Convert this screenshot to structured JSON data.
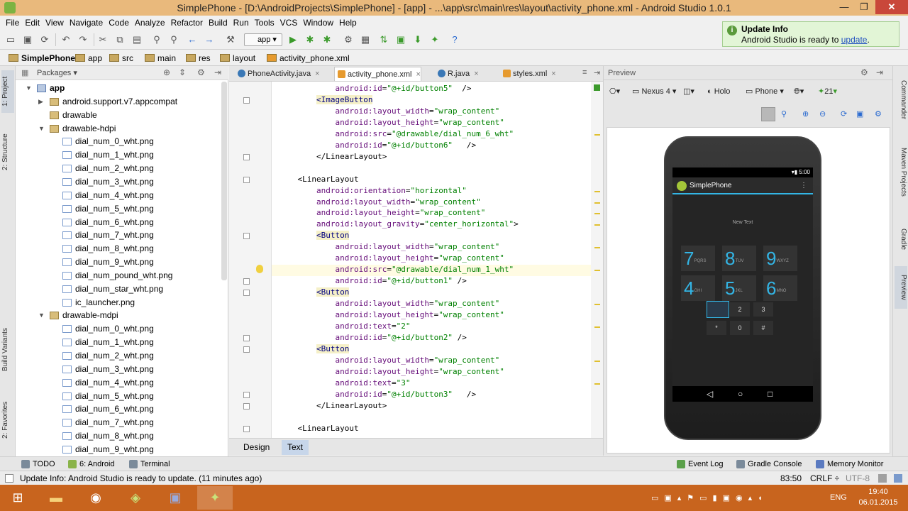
{
  "window": {
    "title": "SimplePhone - [D:\\AndroidProjects\\SimplePhone] - [app] - ...\\app\\src\\main\\res\\layout\\activity_phone.xml - Android Studio 1.0.1"
  },
  "menu": [
    "File",
    "Edit",
    "View",
    "Navigate",
    "Code",
    "Analyze",
    "Refactor",
    "Build",
    "Run",
    "Tools",
    "VCS",
    "Window",
    "Help"
  ],
  "toolbar": {
    "run_config": "app"
  },
  "breadcrumb": [
    "SimplePhone",
    "app",
    "src",
    "main",
    "res",
    "layout",
    "activity_phone.xml"
  ],
  "notification": {
    "title": "Update Info",
    "body": "Android Studio is ready to ",
    "link": "update",
    "suffix": "."
  },
  "left_stripe": [
    "1: Project",
    "2: Structure",
    "Build Variants",
    "2: Favorites"
  ],
  "right_stripe": [
    "Commander",
    "Maven Projects",
    "Gradle",
    "Preview"
  ],
  "project": {
    "view": "Packages",
    "tree": [
      {
        "label": "app",
        "level": 0,
        "type": "module",
        "expanded": true
      },
      {
        "label": "android.support.v7.appcompat",
        "level": 1,
        "type": "folder",
        "expanded": false
      },
      {
        "label": "drawable",
        "level": 1,
        "type": "folder",
        "expanded": null
      },
      {
        "label": "drawable-hdpi",
        "level": 1,
        "type": "folder",
        "expanded": true
      },
      {
        "label": "dial_num_0_wht.png",
        "level": 2,
        "type": "img"
      },
      {
        "label": "dial_num_1_wht.png",
        "level": 2,
        "type": "img"
      },
      {
        "label": "dial_num_2_wht.png",
        "level": 2,
        "type": "img"
      },
      {
        "label": "dial_num_3_wht.png",
        "level": 2,
        "type": "img"
      },
      {
        "label": "dial_num_4_wht.png",
        "level": 2,
        "type": "img"
      },
      {
        "label": "dial_num_5_wht.png",
        "level": 2,
        "type": "img"
      },
      {
        "label": "dial_num_6_wht.png",
        "level": 2,
        "type": "img"
      },
      {
        "label": "dial_num_7_wht.png",
        "level": 2,
        "type": "img"
      },
      {
        "label": "dial_num_8_wht.png",
        "level": 2,
        "type": "img"
      },
      {
        "label": "dial_num_9_wht.png",
        "level": 2,
        "type": "img"
      },
      {
        "label": "dial_num_pound_wht.png",
        "level": 2,
        "type": "img"
      },
      {
        "label": "dial_num_star_wht.png",
        "level": 2,
        "type": "img"
      },
      {
        "label": "ic_launcher.png",
        "level": 2,
        "type": "img"
      },
      {
        "label": "drawable-mdpi",
        "level": 1,
        "type": "folder",
        "expanded": true
      },
      {
        "label": "dial_num_0_wht.png",
        "level": 2,
        "type": "img"
      },
      {
        "label": "dial_num_1_wht.png",
        "level": 2,
        "type": "img"
      },
      {
        "label": "dial_num_2_wht.png",
        "level": 2,
        "type": "img"
      },
      {
        "label": "dial_num_3_wht.png",
        "level": 2,
        "type": "img"
      },
      {
        "label": "dial_num_4_wht.png",
        "level": 2,
        "type": "img"
      },
      {
        "label": "dial_num_5_wht.png",
        "level": 2,
        "type": "img"
      },
      {
        "label": "dial_num_6_wht.png",
        "level": 2,
        "type": "img"
      },
      {
        "label": "dial_num_7_wht.png",
        "level": 2,
        "type": "img"
      },
      {
        "label": "dial_num_8_wht.png",
        "level": 2,
        "type": "img"
      },
      {
        "label": "dial_num_9_wht.png",
        "level": 2,
        "type": "img"
      }
    ]
  },
  "editor_tabs": [
    {
      "label": "PhoneActivity.java",
      "kind": "java",
      "active": false
    },
    {
      "label": "activity_phone.xml",
      "kind": "xml",
      "active": true
    },
    {
      "label": "R.java",
      "kind": "java",
      "active": false
    },
    {
      "label": "styles.xml",
      "kind": "xml",
      "active": false
    }
  ],
  "code_lines": [
    {
      "indent": "            ",
      "parts": [
        [
          "attr",
          "android:id"
        ],
        [
          "plain",
          "="
        ],
        [
          "str",
          "\"@+id/button5\""
        ],
        [
          "plain",
          "  />"
        ]
      ]
    },
    {
      "indent": "        ",
      "parts": [
        [
          "tag",
          "<ImageButton"
        ]
      ]
    },
    {
      "indent": "            ",
      "parts": [
        [
          "attr",
          "android:layout_width"
        ],
        [
          "plain",
          "="
        ],
        [
          "str",
          "\"wrap_content\""
        ]
      ]
    },
    {
      "indent": "            ",
      "parts": [
        [
          "attr",
          "android:layout_height"
        ],
        [
          "plain",
          "="
        ],
        [
          "str",
          "\"wrap_content\""
        ]
      ]
    },
    {
      "indent": "            ",
      "parts": [
        [
          "attr",
          "android:src"
        ],
        [
          "plain",
          "="
        ],
        [
          "str",
          "\"@drawable/dial_num_6_wht\""
        ]
      ]
    },
    {
      "indent": "            ",
      "parts": [
        [
          "attr",
          "android:id"
        ],
        [
          "plain",
          "="
        ],
        [
          "str",
          "\"@+id/button6\""
        ],
        [
          "plain",
          "   />"
        ]
      ]
    },
    {
      "indent": "        ",
      "parts": [
        [
          "plain",
          "</LinearLayout>"
        ]
      ]
    },
    {
      "indent": "",
      "parts": []
    },
    {
      "indent": "    ",
      "parts": [
        [
          "plain",
          "<LinearLayout"
        ]
      ]
    },
    {
      "indent": "        ",
      "parts": [
        [
          "attr",
          "android:orientation"
        ],
        [
          "plain",
          "="
        ],
        [
          "str",
          "\"horizontal\""
        ]
      ]
    },
    {
      "indent": "        ",
      "parts": [
        [
          "attr",
          "android:layout_width"
        ],
        [
          "plain",
          "="
        ],
        [
          "str",
          "\"wrap_content\""
        ]
      ]
    },
    {
      "indent": "        ",
      "parts": [
        [
          "attr",
          "android:layout_height"
        ],
        [
          "plain",
          "="
        ],
        [
          "str",
          "\"wrap_content\""
        ]
      ]
    },
    {
      "indent": "        ",
      "parts": [
        [
          "attr",
          "android:layout_gravity"
        ],
        [
          "plain",
          "="
        ],
        [
          "str",
          "\"center_horizontal\""
        ],
        [
          "plain",
          ">"
        ]
      ]
    },
    {
      "indent": "        ",
      "parts": [
        [
          "tag",
          "<Button"
        ]
      ]
    },
    {
      "indent": "            ",
      "parts": [
        [
          "attr",
          "android:layout_width"
        ],
        [
          "plain",
          "="
        ],
        [
          "str",
          "\"wrap_content\""
        ]
      ]
    },
    {
      "indent": "            ",
      "parts": [
        [
          "attr",
          "android:layout_height"
        ],
        [
          "plain",
          "="
        ],
        [
          "str",
          "\"wrap_content\""
        ]
      ]
    },
    {
      "indent": "            ",
      "parts": [
        [
          "attr",
          "android:src"
        ],
        [
          "plain",
          "="
        ],
        [
          "str",
          "\"@drawable/dial_num_1_wht\""
        ]
      ]
    },
    {
      "indent": "            ",
      "parts": [
        [
          "attr",
          "android:id"
        ],
        [
          "plain",
          "="
        ],
        [
          "str",
          "\"@+id/button1\""
        ],
        [
          "plain",
          " />"
        ]
      ]
    },
    {
      "indent": "        ",
      "parts": [
        [
          "tag",
          "<Button"
        ]
      ]
    },
    {
      "indent": "            ",
      "parts": [
        [
          "attr",
          "android:layout_width"
        ],
        [
          "plain",
          "="
        ],
        [
          "str",
          "\"wrap_content\""
        ]
      ]
    },
    {
      "indent": "            ",
      "parts": [
        [
          "attr",
          "android:layout_height"
        ],
        [
          "plain",
          "="
        ],
        [
          "str",
          "\"wrap_content\""
        ]
      ]
    },
    {
      "indent": "            ",
      "parts": [
        [
          "attr",
          "android:text"
        ],
        [
          "plain",
          "="
        ],
        [
          "str",
          "\"2\""
        ]
      ]
    },
    {
      "indent": "            ",
      "parts": [
        [
          "attr",
          "android:id"
        ],
        [
          "plain",
          "="
        ],
        [
          "str",
          "\"@+id/button2\""
        ],
        [
          "plain",
          " />"
        ]
      ]
    },
    {
      "indent": "        ",
      "parts": [
        [
          "tag",
          "<Button"
        ]
      ]
    },
    {
      "indent": "            ",
      "parts": [
        [
          "attr",
          "android:layout_width"
        ],
        [
          "plain",
          "="
        ],
        [
          "str",
          "\"wrap_content\""
        ]
      ]
    },
    {
      "indent": "            ",
      "parts": [
        [
          "attr",
          "android:layout_height"
        ],
        [
          "plain",
          "="
        ],
        [
          "str",
          "\"wrap_content\""
        ]
      ]
    },
    {
      "indent": "            ",
      "parts": [
        [
          "attr",
          "android:text"
        ],
        [
          "plain",
          "="
        ],
        [
          "str",
          "\"3\""
        ]
      ]
    },
    {
      "indent": "            ",
      "parts": [
        [
          "attr",
          "android:id"
        ],
        [
          "plain",
          "="
        ],
        [
          "str",
          "\"@+id/button3\""
        ],
        [
          "plain",
          "   />"
        ]
      ]
    },
    {
      "indent": "        ",
      "parts": [
        [
          "plain",
          "</LinearLayout>"
        ]
      ]
    },
    {
      "indent": "",
      "parts": []
    },
    {
      "indent": "    ",
      "parts": [
        [
          "plain",
          "<LinearLayout"
        ]
      ]
    }
  ],
  "editor_bottom_tabs": [
    {
      "label": "Design",
      "active": false
    },
    {
      "label": "Text",
      "active": true
    }
  ],
  "preview": {
    "title": "Preview",
    "device": "Nexus 4",
    "theme": "Holo",
    "layout": "Phone",
    "api": "21",
    "phone": {
      "time": "5:00",
      "app_name": "SimplePhone",
      "new_text": "New Text",
      "dial_rows": [
        [
          {
            "d": "7",
            "l": "PQRS"
          },
          {
            "d": "8",
            "l": "TUV"
          },
          {
            "d": "9",
            "l": "WXYZ"
          }
        ],
        [
          {
            "d": "4",
            "l": "GHI"
          },
          {
            "d": "5",
            "l": "JKL"
          },
          {
            "d": "6",
            "l": "MNO"
          }
        ]
      ],
      "small_rows": [
        [
          "",
          "2",
          "3"
        ],
        [
          "*",
          "0",
          "#"
        ]
      ]
    }
  },
  "tool_tabs_left": [
    "TODO",
    "6: Android",
    "Terminal"
  ],
  "tool_tabs_right": [
    "Event Log",
    "Gradle Console",
    "Memory Monitor"
  ],
  "status": {
    "message": "Update Info: Android Studio is ready to update. (11 minutes ago)",
    "position": "83:50",
    "line_sep": "CRLF ÷",
    "encoding": "UTF-8"
  },
  "taskbar": {
    "lang": "ENG",
    "time": "19:40",
    "date": "06.01.2015"
  }
}
